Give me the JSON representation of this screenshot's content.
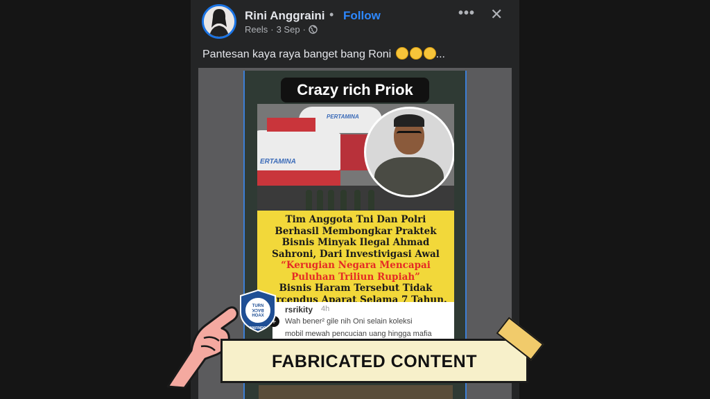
{
  "post": {
    "author": "Rini Anggraini",
    "separator": "•",
    "follow_label": "Follow",
    "source": "Reels",
    "date": "3 Sep",
    "more_icon": "more-icon",
    "close_icon": "close-icon",
    "caption": "Pantesan kaya raya banget bang Roni",
    "caption_suffix": "..."
  },
  "reel": {
    "title": "Crazy rich Priok",
    "truck_label": "PERTAMINA",
    "truck_label_2": "ERTAMINA",
    "news_lines": [
      "Tim Anggota Tni Dan Polri",
      "Berhasil Membongkar Praktek",
      "Bisnis Minyak Ilegal Ahmad",
      "Sahroni, Dari Investivigasi Awal"
    ],
    "news_highlight_lines": [
      "“Kerugian Negara Mencapai",
      "Puluhan Triliun Rupiah”"
    ],
    "news_tail_lines": [
      "Bisnis Haram Tersebut Tidak",
      "Tercendus Aparat Selama 7 Tahun."
    ],
    "comment": {
      "username": "rsrikity",
      "time": "4h",
      "line1": "Wah bener² gile  nih Oni selain koleksi",
      "line2": "mobil mewah pencucian uang hingga mafia"
    }
  },
  "overlay": {
    "label": "FABRICATED CONTENT",
    "seal_text": "MASYARAKAT ANTI FITNAH INDONESIA",
    "seal_name": "MAFINDO",
    "seal_center_line1": "TURN",
    "seal_center_line2": "BACK",
    "seal_center_line3": "HOAX"
  },
  "colors": {
    "background": "#151515",
    "post_bg": "#242526",
    "follow": "#2d88ff",
    "highlight": "#e52b25",
    "news_bg": "#f2d83a",
    "banner_bg": "#f7f0ca"
  }
}
